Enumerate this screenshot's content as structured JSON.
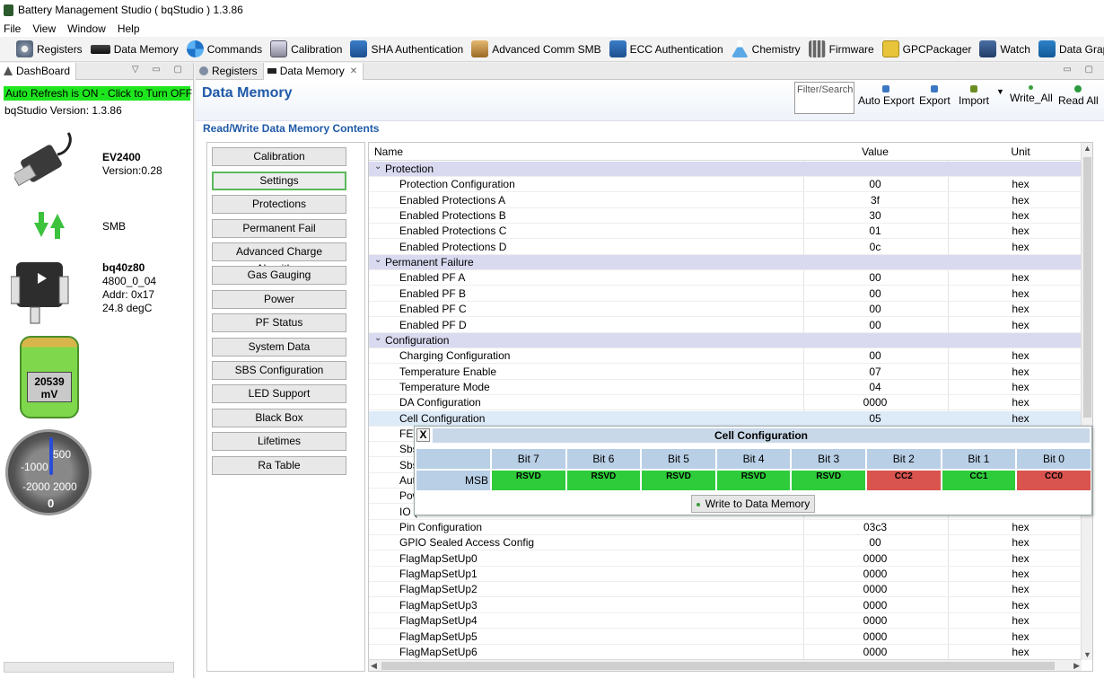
{
  "window": {
    "title": "Battery Management Studio ( bqStudio ) 1.3.86"
  },
  "menu": [
    "File",
    "View",
    "Window",
    "Help"
  ],
  "toolbar": [
    {
      "label": "Registers",
      "icon": "gear-icon"
    },
    {
      "label": "Data Memory",
      "icon": "chip-icon"
    },
    {
      "label": "Commands",
      "icon": "refresh-icon"
    },
    {
      "label": "Calibration",
      "icon": "calibration-icon"
    },
    {
      "label": "SHA Authentication",
      "icon": "lock-icon"
    },
    {
      "label": "Advanced Comm SMB",
      "icon": "package-icon"
    },
    {
      "label": "ECC Authentication",
      "icon": "lock-icon"
    },
    {
      "label": "Chemistry",
      "icon": "flask-icon"
    },
    {
      "label": "Firmware",
      "icon": "firmware-icon"
    },
    {
      "label": "GPCPackager",
      "icon": "packager-icon"
    },
    {
      "label": "Watch",
      "icon": "watch-icon"
    },
    {
      "label": "Data Graph",
      "icon": "graph-icon"
    }
  ],
  "dashboard": {
    "tab": "DashBoard",
    "auto_refresh": "Auto Refresh is ON - Click to Turn OFF",
    "version": "bqStudio Version:  1.3.86",
    "adapter": {
      "name": "EV2400",
      "version": "Version:0.28"
    },
    "bus": "SMB",
    "device": {
      "name": "bq40z80",
      "fw": "4800_0_04",
      "addr": "Addr: 0x17",
      "temp": "24.8 degC"
    },
    "voltage": {
      "value": "20539",
      "unit": "mV"
    },
    "gauge": {
      "t500": "500",
      "tm1000": "-1000",
      "tm2000": "-2000",
      "t2000": "2000",
      "t0": "0"
    }
  },
  "editor": {
    "tabs": [
      "Registers",
      "Data Memory"
    ],
    "title": "Data Memory",
    "filter_placeholder": "Filter/Search",
    "actions": [
      "Auto Export",
      "Export",
      "Import",
      "Write_All",
      "Read All"
    ],
    "subtitle": "Read/Write Data Memory Contents",
    "categories": [
      "Calibration",
      "Settings",
      "Protections",
      "Permanent Fail",
      "Advanced Charge Algorithm",
      "Gas Gauging",
      "Power",
      "PF Status",
      "System Data",
      "SBS Configuration",
      "LED Support",
      "Black Box",
      "Lifetimes",
      "Ra Table"
    ],
    "selected_category": "Settings",
    "columns": {
      "name": "Name",
      "value": "Value",
      "unit": "Unit"
    },
    "rows": [
      {
        "type": "group",
        "name": "Protection"
      },
      {
        "name": "Protection Configuration",
        "value": "00",
        "unit": "hex"
      },
      {
        "name": "Enabled Protections A",
        "value": "3f",
        "unit": "hex"
      },
      {
        "name": "Enabled Protections B",
        "value": "30",
        "unit": "hex"
      },
      {
        "name": "Enabled Protections C",
        "value": "01",
        "unit": "hex"
      },
      {
        "name": "Enabled Protections D",
        "value": "0c",
        "unit": "hex"
      },
      {
        "type": "group",
        "name": "Permanent Failure"
      },
      {
        "name": "Enabled PF A",
        "value": "00",
        "unit": "hex"
      },
      {
        "name": "Enabled PF B",
        "value": "00",
        "unit": "hex"
      },
      {
        "name": "Enabled PF C",
        "value": "00",
        "unit": "hex"
      },
      {
        "name": "Enabled PF D",
        "value": "00",
        "unit": "hex"
      },
      {
        "type": "group",
        "name": "Configuration"
      },
      {
        "name": "Charging Configuration",
        "value": "00",
        "unit": "hex"
      },
      {
        "name": "Temperature Enable",
        "value": "07",
        "unit": "hex"
      },
      {
        "name": "Temperature Mode",
        "value": "04",
        "unit": "hex"
      },
      {
        "name": "DA Configuration",
        "value": "0000",
        "unit": "hex"
      },
      {
        "name": "Cell Configuration",
        "value": "05",
        "unit": "hex",
        "highlight": true
      },
      {
        "name": "FET",
        "value": "",
        "unit": ""
      },
      {
        "name": "Sbs",
        "value": "",
        "unit": ""
      },
      {
        "name": "Sbs",
        "value": "",
        "unit": ""
      },
      {
        "name": "Aut",
        "value": "",
        "unit": ""
      },
      {
        "name": "Pow",
        "value": "",
        "unit": ""
      },
      {
        "name": "IO (",
        "value": "",
        "unit": ""
      },
      {
        "name": "Pin Configuration",
        "value": "03c3",
        "unit": "hex"
      },
      {
        "name": "GPIO Sealed Access Config",
        "value": "00",
        "unit": "hex"
      },
      {
        "name": "FlagMapSetUp0",
        "value": "0000",
        "unit": "hex"
      },
      {
        "name": "FlagMapSetUp1",
        "value": "0000",
        "unit": "hex"
      },
      {
        "name": "FlagMapSetUp2",
        "value": "0000",
        "unit": "hex"
      },
      {
        "name": "FlagMapSetUp3",
        "value": "0000",
        "unit": "hex"
      },
      {
        "name": "FlagMapSetUp4",
        "value": "0000",
        "unit": "hex"
      },
      {
        "name": "FlagMapSetUp5",
        "value": "0000",
        "unit": "hex"
      },
      {
        "name": "FlagMapSetUp6",
        "value": "0000",
        "unit": "hex"
      }
    ]
  },
  "popup": {
    "close": "X",
    "title": "Cell Configuration",
    "row_label": "MSB",
    "bits": [
      {
        "header": "Bit 7",
        "value": "RSVD",
        "color": "#2ecc3a"
      },
      {
        "header": "Bit 6",
        "value": "RSVD",
        "color": "#2ecc3a"
      },
      {
        "header": "Bit 5",
        "value": "RSVD",
        "color": "#2ecc3a"
      },
      {
        "header": "Bit 4",
        "value": "RSVD",
        "color": "#2ecc3a"
      },
      {
        "header": "Bit 3",
        "value": "RSVD",
        "color": "#2ecc3a"
      },
      {
        "header": "Bit 2",
        "value": "CC2",
        "color": "#d9534f"
      },
      {
        "header": "Bit 1",
        "value": "CC1",
        "color": "#2ecc3a"
      },
      {
        "header": "Bit 0",
        "value": "CC0",
        "color": "#d9534f"
      }
    ],
    "write_button": "Write to Data Memory"
  }
}
